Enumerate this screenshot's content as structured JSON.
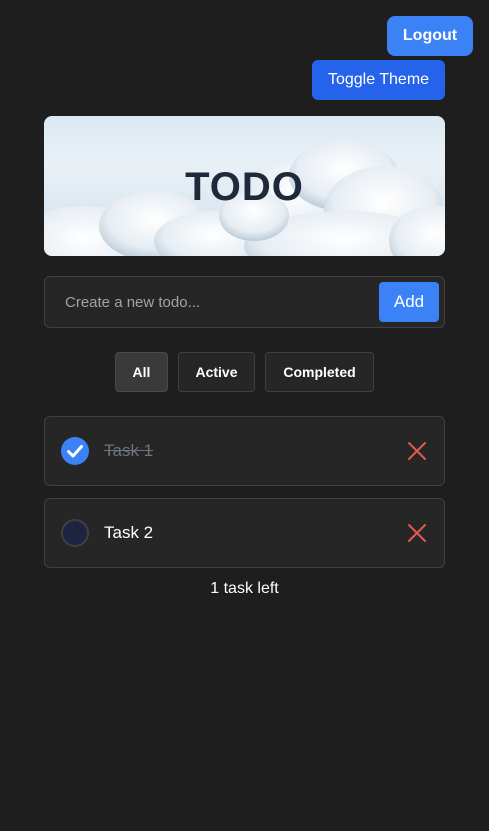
{
  "header": {
    "logout_label": "Logout",
    "toggle_theme_label": "Toggle Theme"
  },
  "banner": {
    "title": "TODO"
  },
  "new_todo": {
    "placeholder": "Create a new todo...",
    "value": "",
    "add_label": "Add"
  },
  "filters": [
    {
      "label": "All",
      "active": true
    },
    {
      "label": "Active",
      "active": false
    },
    {
      "label": "Completed",
      "active": false
    }
  ],
  "todos": [
    {
      "text": "Task 1",
      "completed": true
    },
    {
      "text": "Task 2",
      "completed": false
    }
  ],
  "footer": {
    "tasks_left": "1 task left"
  },
  "icons": {
    "check": "check-icon",
    "delete": "close-icon"
  },
  "colors": {
    "background": "#1e1e1e",
    "accent": "#3b82f6",
    "delete": "#e05a4f",
    "banner_text": "#1e293b"
  }
}
